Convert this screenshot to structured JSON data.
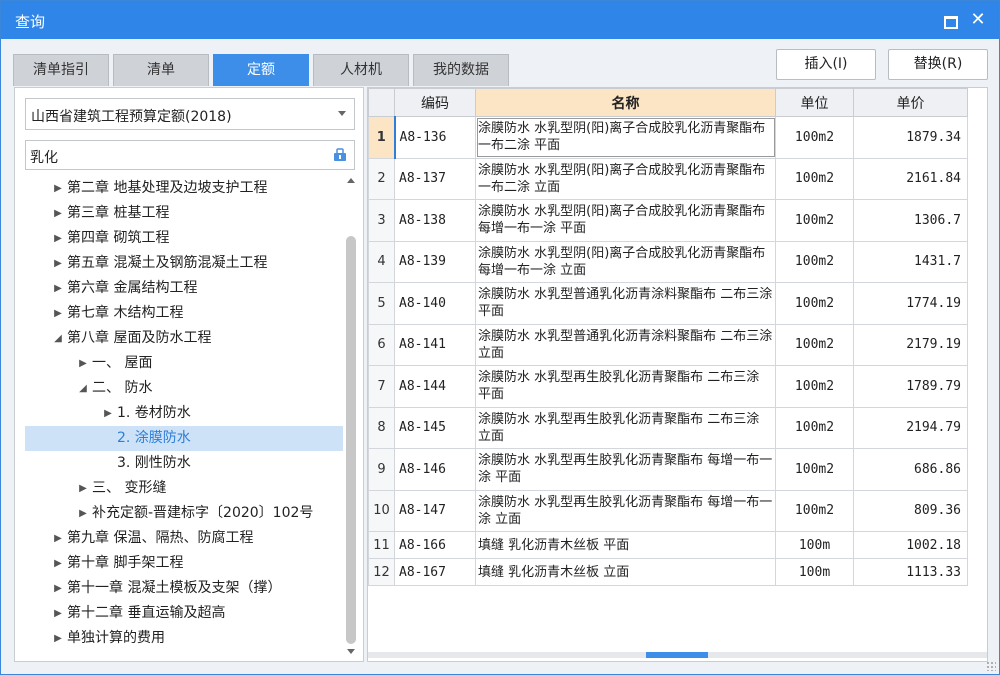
{
  "window": {
    "title": "查询"
  },
  "tabs": [
    {
      "label": "清单指引"
    },
    {
      "label": "清单"
    },
    {
      "label": "定额"
    },
    {
      "label": "人材机"
    },
    {
      "label": "我的数据"
    }
  ],
  "active_tab": "定额",
  "actions": {
    "insert_label": "插入(I)",
    "replace_label": "替换(R)"
  },
  "left": {
    "quota_library": "山西省建筑工程预算定额(2018)",
    "search_value": "乳化",
    "tree": [
      {
        "label": "第二章 地基处理及边坡支护工程",
        "level": 0,
        "state": "collapsed"
      },
      {
        "label": "第三章 桩基工程",
        "level": 0,
        "state": "collapsed"
      },
      {
        "label": "第四章 砌筑工程",
        "level": 0,
        "state": "collapsed"
      },
      {
        "label": "第五章 混凝土及钢筋混凝土工程",
        "level": 0,
        "state": "collapsed"
      },
      {
        "label": "第六章 金属结构工程",
        "level": 0,
        "state": "collapsed"
      },
      {
        "label": "第七章 木结构工程",
        "level": 0,
        "state": "collapsed"
      },
      {
        "label": "第八章 屋面及防水工程",
        "level": 0,
        "state": "expanded"
      },
      {
        "label": "一、 屋面",
        "level": 1,
        "state": "collapsed"
      },
      {
        "label": "二、 防水",
        "level": 1,
        "state": "expanded"
      },
      {
        "label": "1. 卷材防水",
        "level": 2,
        "state": "collapsed"
      },
      {
        "label": "2. 涂膜防水",
        "level": 2,
        "state": "leaf",
        "selected": true
      },
      {
        "label": "3. 刚性防水",
        "level": 2,
        "state": "leaf"
      },
      {
        "label": "三、 变形缝",
        "level": 1,
        "state": "collapsed"
      },
      {
        "label": "补充定额-晋建标字〔2020〕102号",
        "level": 1,
        "state": "collapsed"
      },
      {
        "label": "第九章 保温、隔热、防腐工程",
        "level": 0,
        "state": "collapsed"
      },
      {
        "label": "第十章 脚手架工程",
        "level": 0,
        "state": "collapsed"
      },
      {
        "label": "第十一章 混凝土模板及支架（撑）",
        "level": 0,
        "state": "collapsed"
      },
      {
        "label": "第十二章 垂直运输及超高",
        "level": 0,
        "state": "collapsed"
      },
      {
        "label": "单独计算的费用",
        "level": 0,
        "state": "collapsed"
      }
    ]
  },
  "table": {
    "headers": {
      "index": "",
      "code": "编码",
      "name": "名称",
      "unit": "单位",
      "price": "单价"
    },
    "rows": [
      {
        "idx": "1",
        "code": "A8-136",
        "name": "涂膜防水 水乳型阴(阳)离子合成胶乳化沥青聚酯布 一布二涂 平面",
        "unit": "100m2",
        "price": "1879.34",
        "current": true
      },
      {
        "idx": "2",
        "code": "A8-137",
        "name": "涂膜防水 水乳型阴(阳)离子合成胶乳化沥青聚酯布 一布二涂 立面",
        "unit": "100m2",
        "price": "2161.84"
      },
      {
        "idx": "3",
        "code": "A8-138",
        "name": "涂膜防水 水乳型阴(阳)离子合成胶乳化沥青聚酯布 每增一布一涂 平面",
        "unit": "100m2",
        "price": "1306.7"
      },
      {
        "idx": "4",
        "code": "A8-139",
        "name": "涂膜防水 水乳型阴(阳)离子合成胶乳化沥青聚酯布 每增一布一涂 立面",
        "unit": "100m2",
        "price": "1431.7"
      },
      {
        "idx": "5",
        "code": "A8-140",
        "name": "涂膜防水 水乳型普通乳化沥青涂料聚酯布 二布三涂 平面",
        "unit": "100m2",
        "price": "1774.19"
      },
      {
        "idx": "6",
        "code": "A8-141",
        "name": "涂膜防水 水乳型普通乳化沥青涂料聚酯布 二布三涂 立面",
        "unit": "100m2",
        "price": "2179.19"
      },
      {
        "idx": "7",
        "code": "A8-144",
        "name": "涂膜防水 水乳型再生胶乳化沥青聚酯布 二布三涂 平面",
        "unit": "100m2",
        "price": "1789.79"
      },
      {
        "idx": "8",
        "code": "A8-145",
        "name": "涂膜防水 水乳型再生胶乳化沥青聚酯布 二布三涂 立面",
        "unit": "100m2",
        "price": "2194.79"
      },
      {
        "idx": "9",
        "code": "A8-146",
        "name": "涂膜防水 水乳型再生胶乳化沥青聚酯布 每增一布一涂 平面",
        "unit": "100m2",
        "price": "686.86"
      },
      {
        "idx": "10",
        "code": "A8-147",
        "name": "涂膜防水 水乳型再生胶乳化沥青聚酯布 每增一布一涂 立面",
        "unit": "100m2",
        "price": "809.36"
      },
      {
        "idx": "11",
        "code": "A8-166",
        "name": "填缝 乳化沥青木丝板 平面",
        "unit": "100m",
        "price": "1002.18"
      },
      {
        "idx": "12",
        "code": "A8-167",
        "name": "填缝 乳化沥青木丝板 立面",
        "unit": "100m",
        "price": "1113.33"
      }
    ]
  },
  "colors": {
    "titlebar": "#2f86e8",
    "active_tab": "#3d8ee8",
    "selection": "#cde2f7",
    "name_header": "#fbe5c5"
  }
}
